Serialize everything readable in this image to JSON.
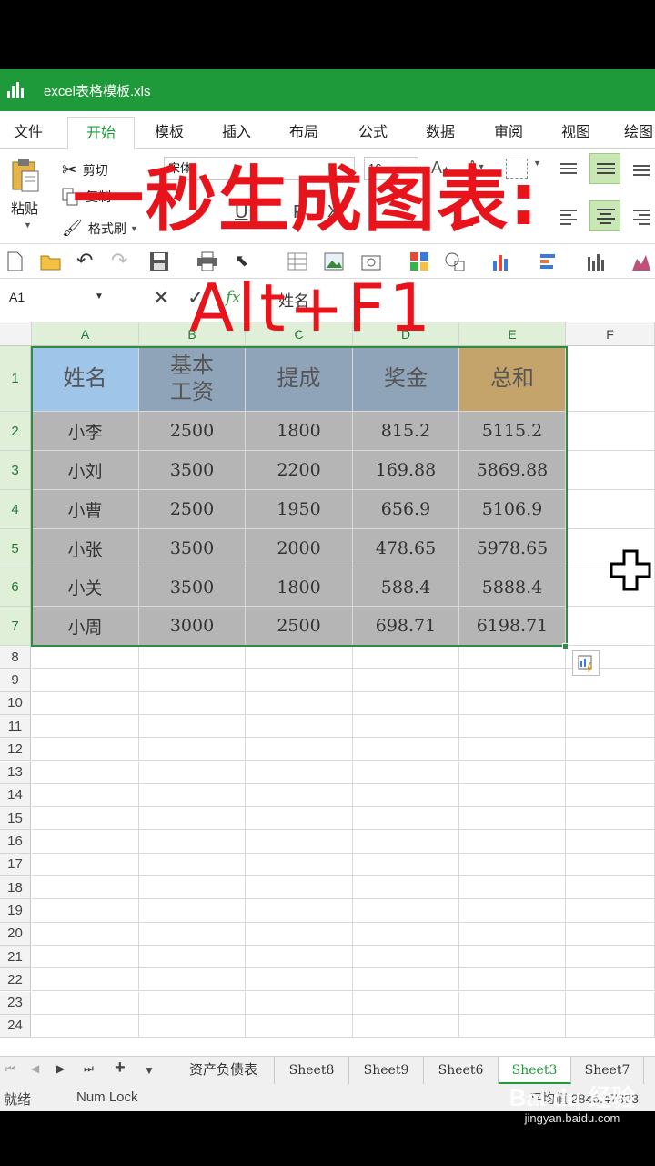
{
  "titlebar": {
    "filename": "excel表格模板.xls"
  },
  "menu": {
    "tabs": [
      {
        "label": "文件"
      },
      {
        "label": "开始"
      },
      {
        "label": "模板"
      },
      {
        "label": "插入"
      },
      {
        "label": "布局"
      },
      {
        "label": "公式"
      },
      {
        "label": "数据"
      },
      {
        "label": "审阅"
      },
      {
        "label": "视图"
      },
      {
        "label": "绘图"
      }
    ],
    "active": "开始"
  },
  "ribbon": {
    "paste_label": "粘贴",
    "cut_label": "剪切",
    "copy_label": "复制",
    "format_painter_label": "格式刷",
    "font_name": "宋体",
    "font_size": "16"
  },
  "formula_bar": {
    "cell_ref": "A1",
    "fx": "fx",
    "content": "姓名"
  },
  "overlay": {
    "line1": "一秒生成图表:",
    "line2": "Alt+F1"
  },
  "grid": {
    "columns": [
      "A",
      "B",
      "C",
      "D",
      "E",
      "F"
    ],
    "rows": [
      "1",
      "2",
      "3",
      "4",
      "5",
      "6",
      "7",
      "8",
      "9",
      "10",
      "11",
      "12",
      "13",
      "14",
      "15",
      "16",
      "17",
      "18",
      "19",
      "20",
      "21",
      "22",
      "23",
      "24"
    ],
    "header": [
      "姓名",
      "基本\n工资",
      "提成",
      "奖金",
      "总和"
    ],
    "data": [
      [
        "小李",
        "2500",
        "1800",
        "815.2",
        "5115.2"
      ],
      [
        "小刘",
        "3500",
        "2200",
        "169.88",
        "5869.88"
      ],
      [
        "小曹",
        "2500",
        "1950",
        "656.9",
        "5106.9"
      ],
      [
        "小张",
        "3500",
        "2000",
        "478.65",
        "5978.65"
      ],
      [
        "小关",
        "3500",
        "1800",
        "588.4",
        "5888.4"
      ],
      [
        "小周",
        "3000",
        "2500",
        "698.71",
        "6198.71"
      ]
    ],
    "colors": {
      "name_header": "#9fc5e8",
      "col_header": "#8fa4b8",
      "sum_header": "#c4a46a",
      "data_fill": "#b5b5b5"
    }
  },
  "sheets": {
    "tabs": [
      "资产负债表",
      "Sheet8",
      "Sheet9",
      "Sheet6",
      "Sheet3",
      "Sheet7"
    ],
    "active": "Sheet3"
  },
  "status": {
    "ready": "就绪",
    "numlock": "Num Lock",
    "average": "平均值:2846.47833"
  },
  "watermark": {
    "brand": "Bai du 经验",
    "url": "jingyan.baidu.com"
  }
}
